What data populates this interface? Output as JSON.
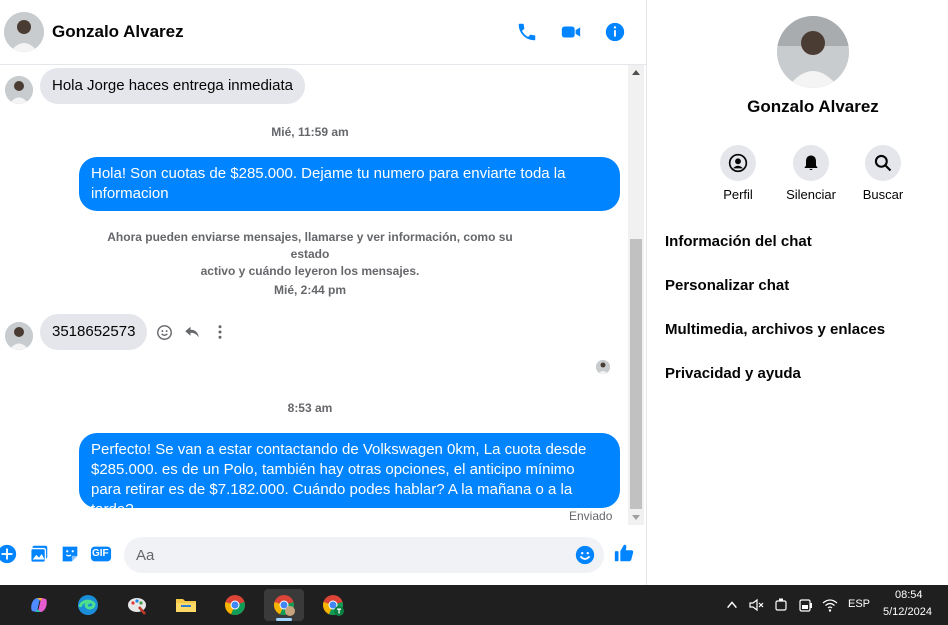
{
  "header": {
    "contact_name": "Gonzalo Alvarez",
    "icons": [
      "phone-icon",
      "video-icon",
      "info-icon"
    ]
  },
  "messages": {
    "first_incoming": "Hola Jorge haces entrega inmediata",
    "ts1": "Mié, 11:59 am",
    "outgoing1": "Hola! Son cuotas de $285.000. Dejame tu numero para enviarte toda la informacion",
    "system_line1": "Ahora pueden enviarse mensajes, llamarse y ver información, como su estado",
    "system_line2": "activo y cuándo leyeron los mensajes.",
    "ts2": "Mié, 2:44 pm",
    "incoming2": "3518652573",
    "ts3": "8:53 am",
    "outgoing2": "Perfecto!  Se van a estar contactando de Volkswagen 0km, La cuota desde $285.000. es de un Polo, también hay otras opciones, el anticipo mínimo para retirar es de $7.182.000. Cuándo podes hablar? A la mañana o a la tarde?",
    "status": "Enviado"
  },
  "composer": {
    "placeholder": "Aa",
    "gif_label": "GIF"
  },
  "info_panel": {
    "name": "Gonzalo Alvarez",
    "actions": [
      {
        "label": "Perfil",
        "icon": "profile-icon"
      },
      {
        "label": "Silenciar",
        "icon": "bell-icon"
      },
      {
        "label": "Buscar",
        "icon": "search-icon"
      }
    ],
    "menu": [
      "Información del chat",
      "Personalizar chat",
      "Multimedia, archivos y enlaces",
      "Privacidad y ayuda"
    ]
  },
  "taskbar": {
    "language": "ESP",
    "time": "08:54",
    "date": "5/12/2024"
  },
  "colors": {
    "accent": "#0084ff",
    "incoming_bubble": "#e4e6eb",
    "taskbar": "#1f1f1f"
  }
}
